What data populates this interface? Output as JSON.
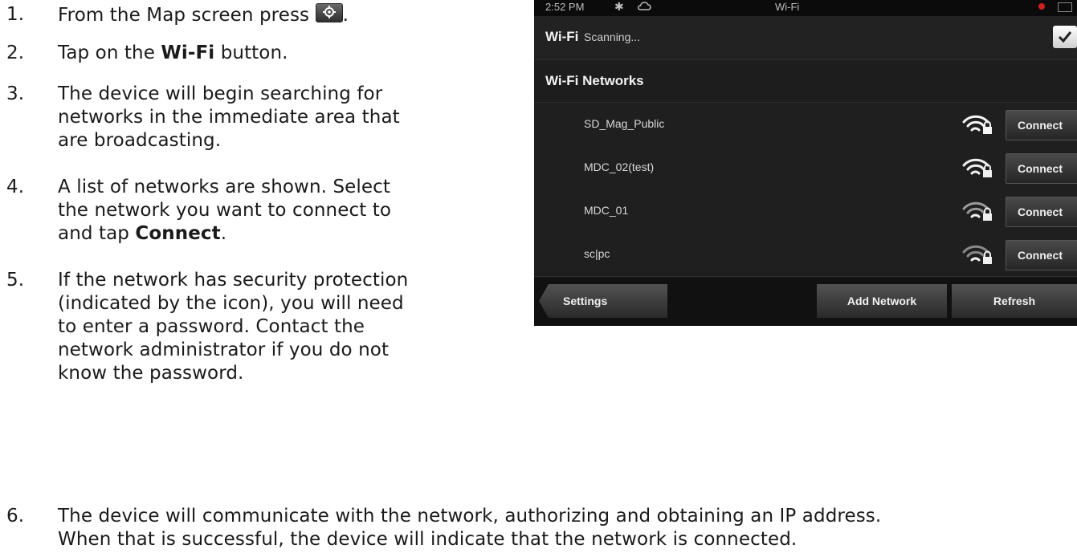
{
  "steps": [
    {
      "num": "1.",
      "text": "From the Map screen press",
      "tail": "."
    },
    {
      "num": "2.",
      "pre": "Tap on the ",
      "bold": "Wi-Fi",
      "post": " button."
    },
    {
      "num": "3.",
      "lines": [
        "The device will begin searching for",
        "networks in the immediate area that",
        "are broadcasting."
      ]
    },
    {
      "num": "4.",
      "lines": [
        "A list of networks are shown.  Select",
        "the network you want to connect to"
      ],
      "pre": "and tap ",
      "bold": "Connect",
      "post": "."
    },
    {
      "num": "5.",
      "lines": [
        "If the network has security protection",
        "(indicated by the  icon), you will need",
        "to enter a password. Contact the",
        "network administrator if you do not",
        "know the password."
      ]
    },
    {
      "num": "6.",
      "lines": [
        "The device will communicate with the network, authorizing and obtaining an IP address.",
        "When that is successful, the device will indicate that the network is connected."
      ]
    }
  ],
  "device": {
    "status": {
      "time": "2:52 PM",
      "bluetooth": "✱",
      "title": "Wi-Fi"
    },
    "wifi_row": {
      "label": "Wi-Fi",
      "status": "Scanning...",
      "checked": true
    },
    "networks_header": "Wi-Fi Networks",
    "networks": [
      {
        "name": "SD_Mag_Public",
        "button": "Connect",
        "secured": true
      },
      {
        "name": "MDC_02(test)",
        "button": "Connect",
        "secured": true
      },
      {
        "name": "MDC_01",
        "button": "Connect",
        "secured": true
      },
      {
        "name": "sc|pc",
        "button": "Connect",
        "secured": true
      }
    ],
    "bottom": {
      "settings": "Settings",
      "add": "Add Network",
      "refresh": "Refresh"
    }
  },
  "colors": {
    "device_bg": "#1b1b1b",
    "text": "#1a1a1a",
    "button": "#3a3a3a"
  }
}
